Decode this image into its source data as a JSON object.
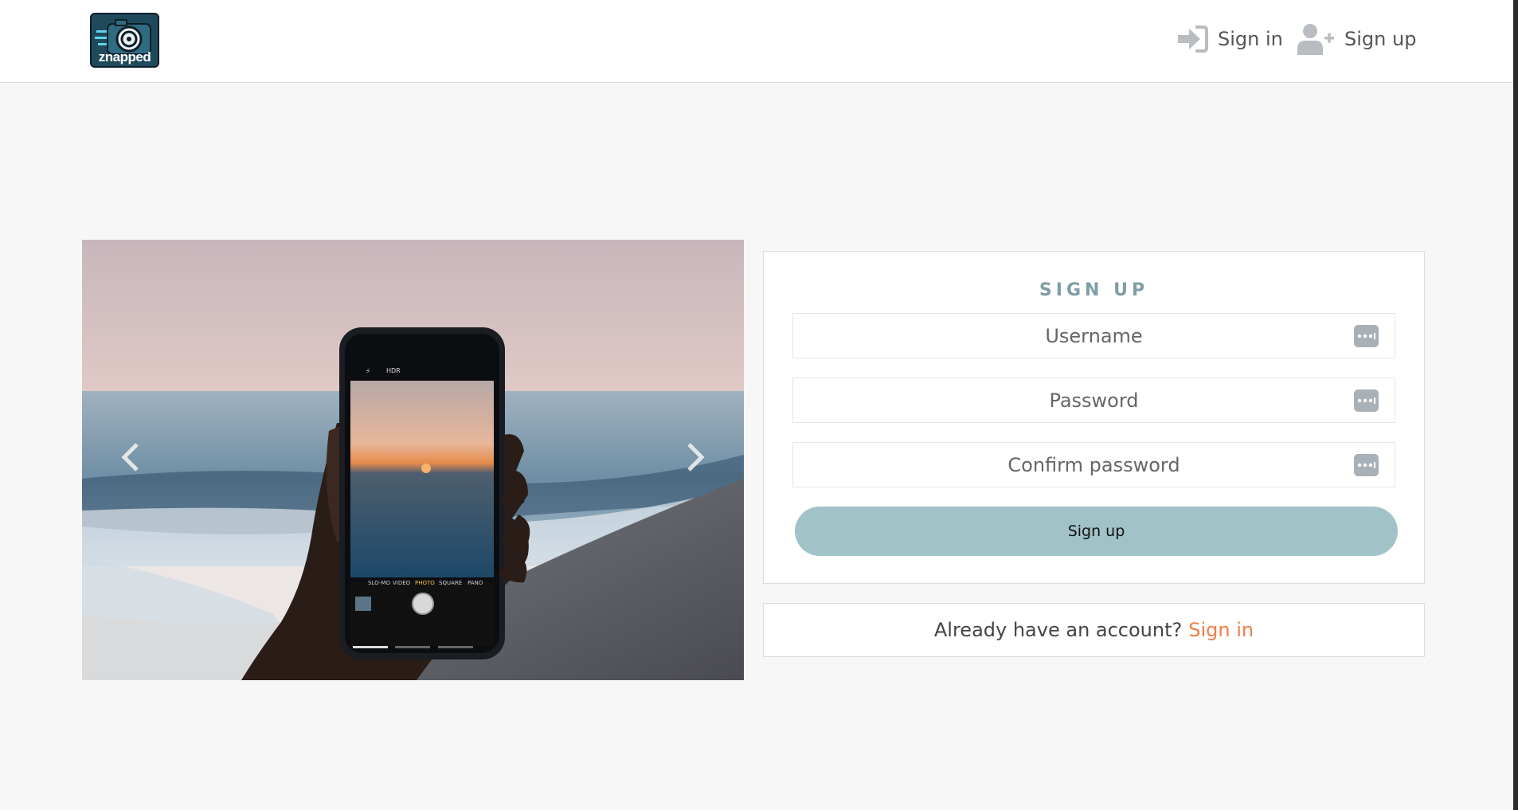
{
  "header": {
    "logo_text": "znapped",
    "signin_label": "Sign in",
    "signup_label": "Sign up"
  },
  "carousel": {
    "prev_icon": "chevron-left-icon",
    "next_icon": "chevron-right-icon",
    "phone_modes": [
      "SLO-MO",
      "VIDEO",
      "PHOTO",
      "SQUARE",
      "PANO"
    ],
    "phone_top": [
      "HDR"
    ]
  },
  "form": {
    "title": "SIGN UP",
    "username_placeholder": "Username",
    "password_placeholder": "Password",
    "confirm_placeholder": "Confirm password",
    "submit_label": "Sign up"
  },
  "footer": {
    "question": "Already have an account?",
    "signin_link": "Sign in"
  },
  "colors": {
    "accent": "#a1c3c8",
    "title": "#7e9ea6",
    "link": "#f07e47"
  }
}
